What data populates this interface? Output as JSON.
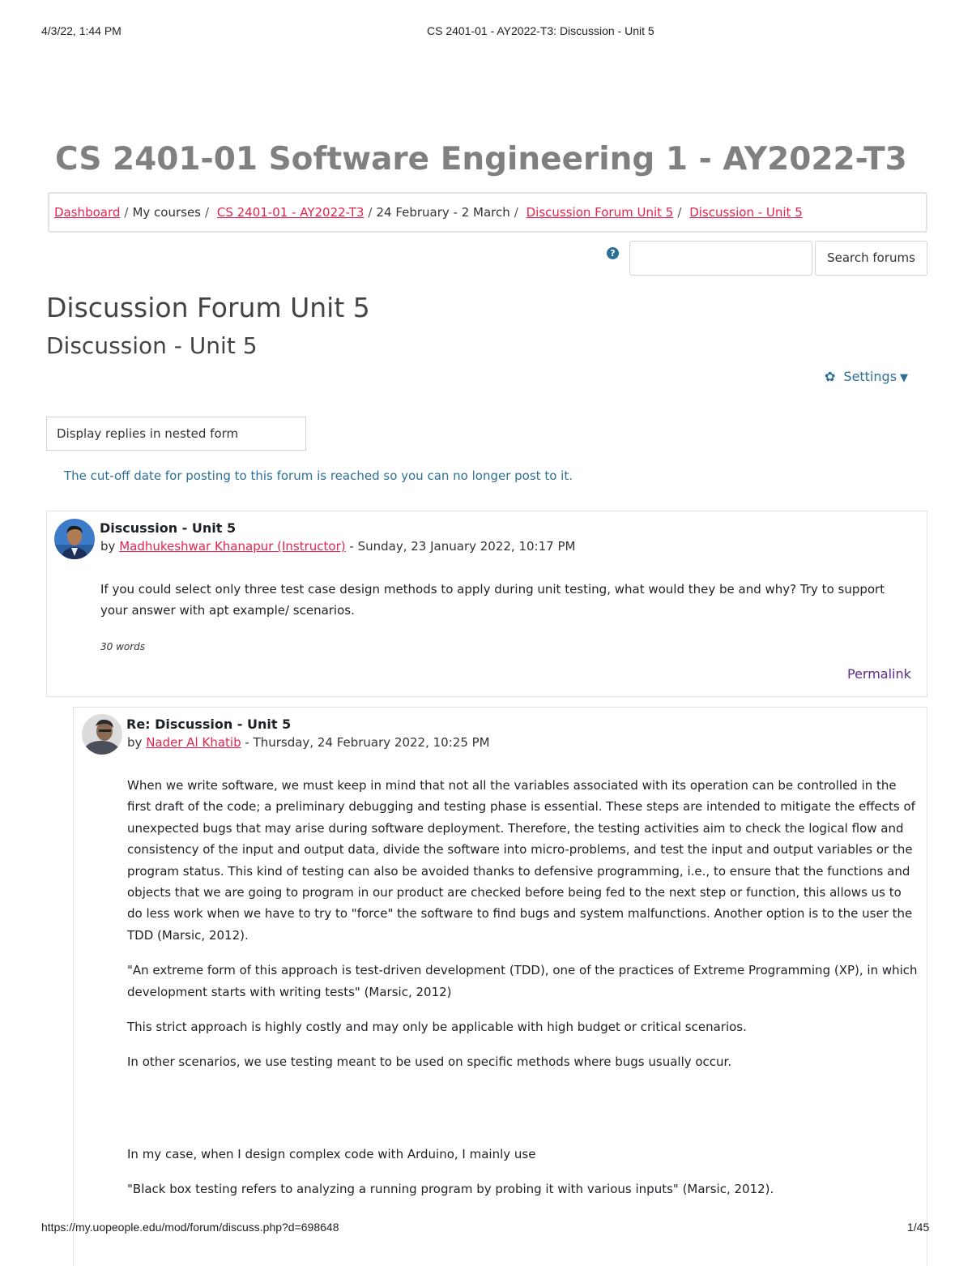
{
  "print_header": {
    "datetime": "4/3/22, 1:44 PM",
    "doc_title": "CS 2401-01 - AY2022-T3: Discussion - Unit 5"
  },
  "print_footer": {
    "url": "https://my.uopeople.edu/mod/forum/discuss.php?d=698648",
    "page": "1/45"
  },
  "course_title": "CS 2401-01 Software Engineering 1 - AY2022-T3",
  "breadcrumb": {
    "items": [
      "Dashboard",
      "My courses",
      "CS 2401-01 - AY2022-T3",
      "24 February - 2 March",
      "Discussion Forum Unit 5",
      "Discussion - Unit 5"
    ],
    "separator": "/"
  },
  "search": {
    "button_label": "Search forums",
    "value": ""
  },
  "forum_title": "Discussion Forum Unit 5",
  "discussion_title": "Discussion - Unit 5",
  "settings_label": "Settings",
  "display_mode": "Display replies in nested form",
  "cutoff_notice": "The cut-off date for posting to this forum is reached so you can no longer post to it.",
  "colors": {
    "link": "#e8224d",
    "accent": "#2a6f97",
    "permalink": "#5b2d8e",
    "course_title": "#808080"
  },
  "posts": [
    {
      "subject": "Discussion - Unit 5",
      "by": "by",
      "author": "Madhukeshwar Khanapur (Instructor)",
      "date": "- Sunday, 23 January 2022, 10:17 PM",
      "body": [
        "If you could select only three test case design methods to apply during unit testing, what would they be and why? Try to support your answer with apt example/ scenarios."
      ],
      "word_count": "30 words",
      "permalink": "Permalink"
    },
    {
      "subject": "Re: Discussion - Unit 5",
      "by": "by",
      "author": "Nader Al Khatib",
      "date": "- Thursday, 24 February 2022, 10:25 PM",
      "body": [
        "When we write software, we must keep in mind that not all the variables associated with its operation can be controlled in the first draft of the code; a preliminary debugging and testing phase is essential. These steps are intended to mitigate the effects of unexpected bugs that may arise during software deployment. Therefore, the testing activities aim to check the logical flow and consistency of the input and output data, divide the software into micro-problems, and test the input and output variables or the program status. This kind of testing can also be avoided thanks to defensive programming, i.e., to ensure that the functions and objects that we are going to program in our product are checked before being fed to the next step or function, this allows us to do less work when we have to try to \"force\" the software to find bugs and system malfunctions. Another option is to the user the TDD (Marsic, 2012).",
        "\"An extreme form of this approach is test-driven development (TDD), one of the practices of Extreme Programming (XP), in which development starts with writing tests\" (Marsic, 2012)",
        "This strict approach is highly costly and may only be applicable with high budget or critical scenarios.",
        "In other scenarios, we use testing meant to be used on specific methods where bugs usually occur.",
        "In my case, when I design complex code with Arduino, I mainly use",
        "\"Black box testing refers to analyzing a running program by probing it with various inputs\" (Marsic, 2012)."
      ]
    }
  ]
}
